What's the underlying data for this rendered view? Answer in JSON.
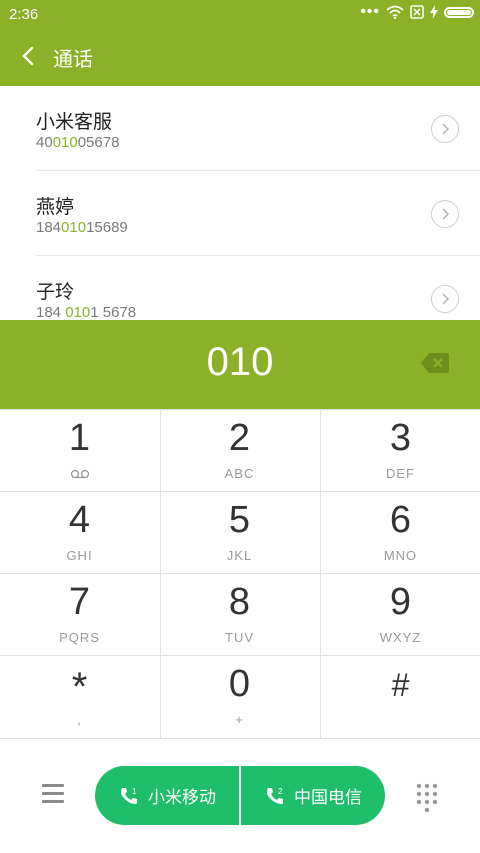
{
  "status_bar": {
    "time": "2:36",
    "icons": [
      "more-dots-icon",
      "wifi-icon",
      "no-sim-icon",
      "charging-icon",
      "battery-icon"
    ]
  },
  "header": {
    "title": "通话"
  },
  "contacts": [
    {
      "name": "小米客服",
      "number_pre": "40",
      "number_match": "010",
      "number_post": "05678"
    },
    {
      "name": "燕婷",
      "number_pre": "184",
      "number_match": "010",
      "number_post": "15689"
    },
    {
      "name": "子玲",
      "number_pre": "184 ",
      "number_match": "010",
      "number_post": "1 5678"
    }
  ],
  "dial_display": {
    "number": "010"
  },
  "keypad": [
    {
      "digit": "1",
      "letters": ""
    },
    {
      "digit": "2",
      "letters": "ABC"
    },
    {
      "digit": "3",
      "letters": "DEF"
    },
    {
      "digit": "4",
      "letters": "GHI"
    },
    {
      "digit": "5",
      "letters": "JKL"
    },
    {
      "digit": "6",
      "letters": "MNO"
    },
    {
      "digit": "7",
      "letters": "PQRS"
    },
    {
      "digit": "8",
      "letters": "TUV"
    },
    {
      "digit": "9",
      "letters": "WXYZ"
    },
    {
      "digit": "*",
      "letters": ","
    },
    {
      "digit": "0",
      "letters": "+"
    },
    {
      "digit": "#",
      "letters": ""
    }
  ],
  "call_buttons": [
    {
      "sim": "1",
      "label": "小米移动"
    },
    {
      "sim": "2",
      "label": "中国电信"
    }
  ],
  "colors": {
    "accent": "#8bb128",
    "call": "#1ebe6a",
    "highlight": "#8bb128"
  }
}
